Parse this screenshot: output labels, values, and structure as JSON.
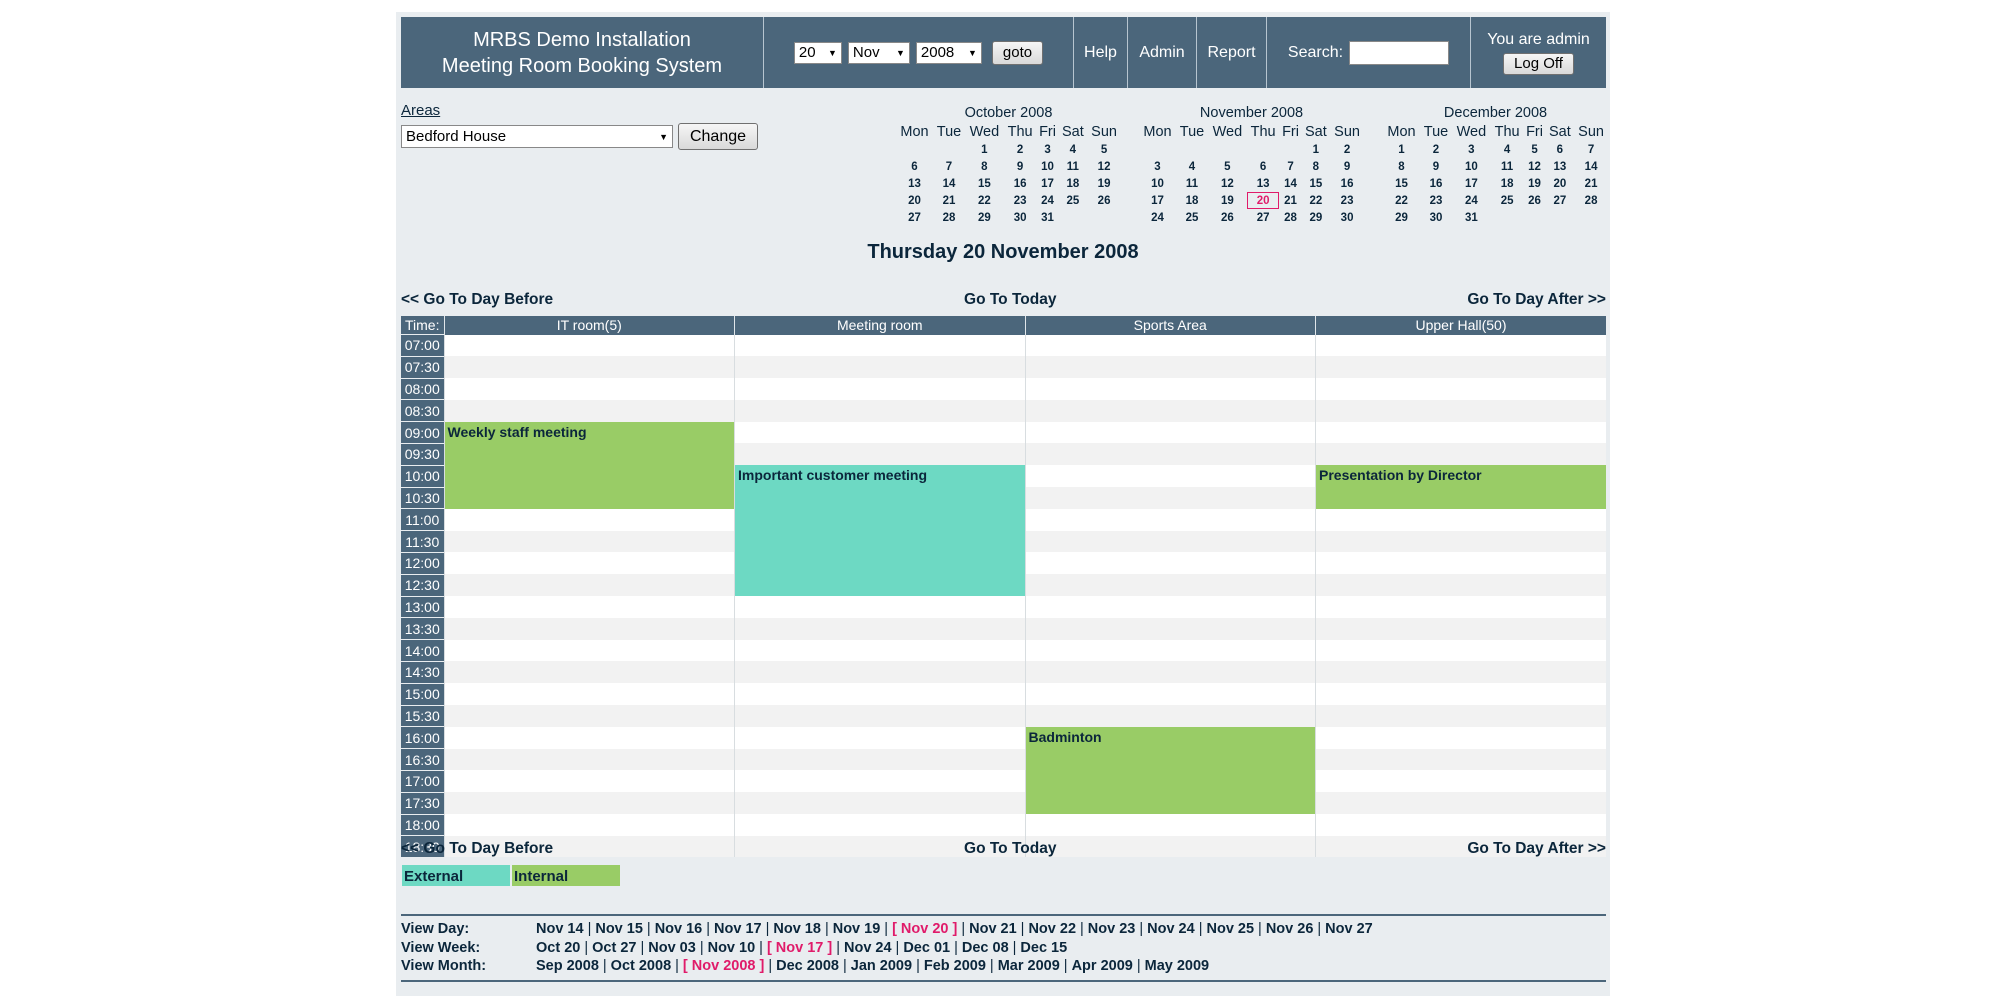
{
  "header": {
    "title_line1": "MRBS Demo Installation",
    "title_line2": "Meeting Room Booking System",
    "day_value": "20",
    "month_value": "Nov",
    "year_value": "2008",
    "goto_label": "goto",
    "help_label": "Help",
    "admin_label": "Admin",
    "report_label": "Report",
    "search_label": "Search:",
    "search_value": "",
    "user_text": "You are admin",
    "logoff_label": "Log Off"
  },
  "areas": {
    "label": "Areas",
    "selected": "Bedford House",
    "change_label": "Change"
  },
  "calendars": [
    {
      "title": "October 2008",
      "weekdays": [
        "Mon",
        "Tue",
        "Wed",
        "Thu",
        "Fri",
        "Sat",
        "Sun"
      ],
      "weeks": [
        [
          "",
          "",
          "1",
          "2",
          "3",
          "4",
          "5"
        ],
        [
          "6",
          "7",
          "8",
          "9",
          "10",
          "11",
          "12"
        ],
        [
          "13",
          "14",
          "15",
          "16",
          "17",
          "18",
          "19"
        ],
        [
          "20",
          "21",
          "22",
          "23",
          "24",
          "25",
          "26"
        ],
        [
          "27",
          "28",
          "29",
          "30",
          "31",
          "",
          ""
        ]
      ],
      "current": ""
    },
    {
      "title": "November 2008",
      "weekdays": [
        "Mon",
        "Tue",
        "Wed",
        "Thu",
        "Fri",
        "Sat",
        "Sun"
      ],
      "weeks": [
        [
          "",
          "",
          "",
          "",
          "",
          "1",
          "2"
        ],
        [
          "3",
          "4",
          "5",
          "6",
          "7",
          "8",
          "9"
        ],
        [
          "10",
          "11",
          "12",
          "13",
          "14",
          "15",
          "16"
        ],
        [
          "17",
          "18",
          "19",
          "20",
          "21",
          "22",
          "23"
        ],
        [
          "24",
          "25",
          "26",
          "27",
          "28",
          "29",
          "30"
        ]
      ],
      "current": "20"
    },
    {
      "title": "December 2008",
      "weekdays": [
        "Mon",
        "Tue",
        "Wed",
        "Thu",
        "Fri",
        "Sat",
        "Sun"
      ],
      "weeks": [
        [
          "1",
          "2",
          "3",
          "4",
          "5",
          "6",
          "7"
        ],
        [
          "8",
          "9",
          "10",
          "11",
          "12",
          "13",
          "14"
        ],
        [
          "15",
          "16",
          "17",
          "18",
          "19",
          "20",
          "21"
        ],
        [
          "22",
          "23",
          "24",
          "25",
          "26",
          "27",
          "28"
        ],
        [
          "29",
          "30",
          "31",
          "",
          "",
          "",
          ""
        ]
      ],
      "current": ""
    }
  ],
  "day_title": "Thursday 20 November 2008",
  "nav": {
    "before": "<< Go To Day Before",
    "today": "Go To Today",
    "after": "Go To Day After >>"
  },
  "grid": {
    "time_header": "Time:",
    "rooms": [
      "IT room(5)",
      "Meeting room",
      "Sports Area",
      "Upper Hall(50)"
    ],
    "times": [
      "07:00",
      "07:30",
      "08:00",
      "08:30",
      "09:00",
      "09:30",
      "10:00",
      "10:30",
      "11:00",
      "11:30",
      "12:00",
      "12:30",
      "13:00",
      "13:30",
      "14:00",
      "14:30",
      "15:00",
      "15:30",
      "16:00",
      "16:30",
      "17:00",
      "17:30",
      "18:00",
      "18:30"
    ],
    "bookings": [
      {
        "room": 0,
        "start": "09:00",
        "slots": 4,
        "title": "Weekly staff meeting",
        "type": "internal"
      },
      {
        "room": 1,
        "start": "10:00",
        "slots": 6,
        "title": "Important customer meeting",
        "type": "external"
      },
      {
        "room": 3,
        "start": "10:00",
        "slots": 2,
        "title": "Presentation by Director",
        "type": "internal"
      },
      {
        "room": 2,
        "start": "16:00",
        "slots": 4,
        "title": "Badminton",
        "type": "internal"
      }
    ]
  },
  "legend": [
    {
      "label": "External",
      "type": "external"
    },
    {
      "label": "Internal",
      "type": "internal"
    }
  ],
  "footer": {
    "view_day_label": "View Day:",
    "view_day_items": [
      "Nov 14",
      "Nov 15",
      "Nov 16",
      "Nov 17",
      "Nov 18",
      "Nov 19",
      "[ Nov 20 ]",
      "Nov 21",
      "Nov 22",
      "Nov 23",
      "Nov 24",
      "Nov 25",
      "Nov 26",
      "Nov 27"
    ],
    "view_day_current": "[ Nov 20 ]",
    "view_week_label": "View Week:",
    "view_week_items": [
      "Oct 20",
      "Oct 27",
      "Nov 03",
      "Nov 10",
      "[ Nov 17 ]",
      "Nov 24",
      "Dec 01",
      "Dec 08",
      "Dec 15"
    ],
    "view_week_current": "[ Nov 17 ]",
    "view_month_label": "View Month:",
    "view_month_items": [
      "Sep 2008",
      "Oct 2008",
      "[ Nov 2008 ]",
      "Dec 2008",
      "Jan 2009",
      "Feb 2009",
      "Mar 2009",
      "Apr 2009",
      "May 2009"
    ],
    "view_month_current": "[ Nov 2008 ]"
  },
  "colors": {
    "header_bg": "#4b667b",
    "page_bg": "#e9edf0",
    "internal": "#99cc66",
    "external": "#6dd9c3",
    "highlight": "#e01b6a"
  }
}
